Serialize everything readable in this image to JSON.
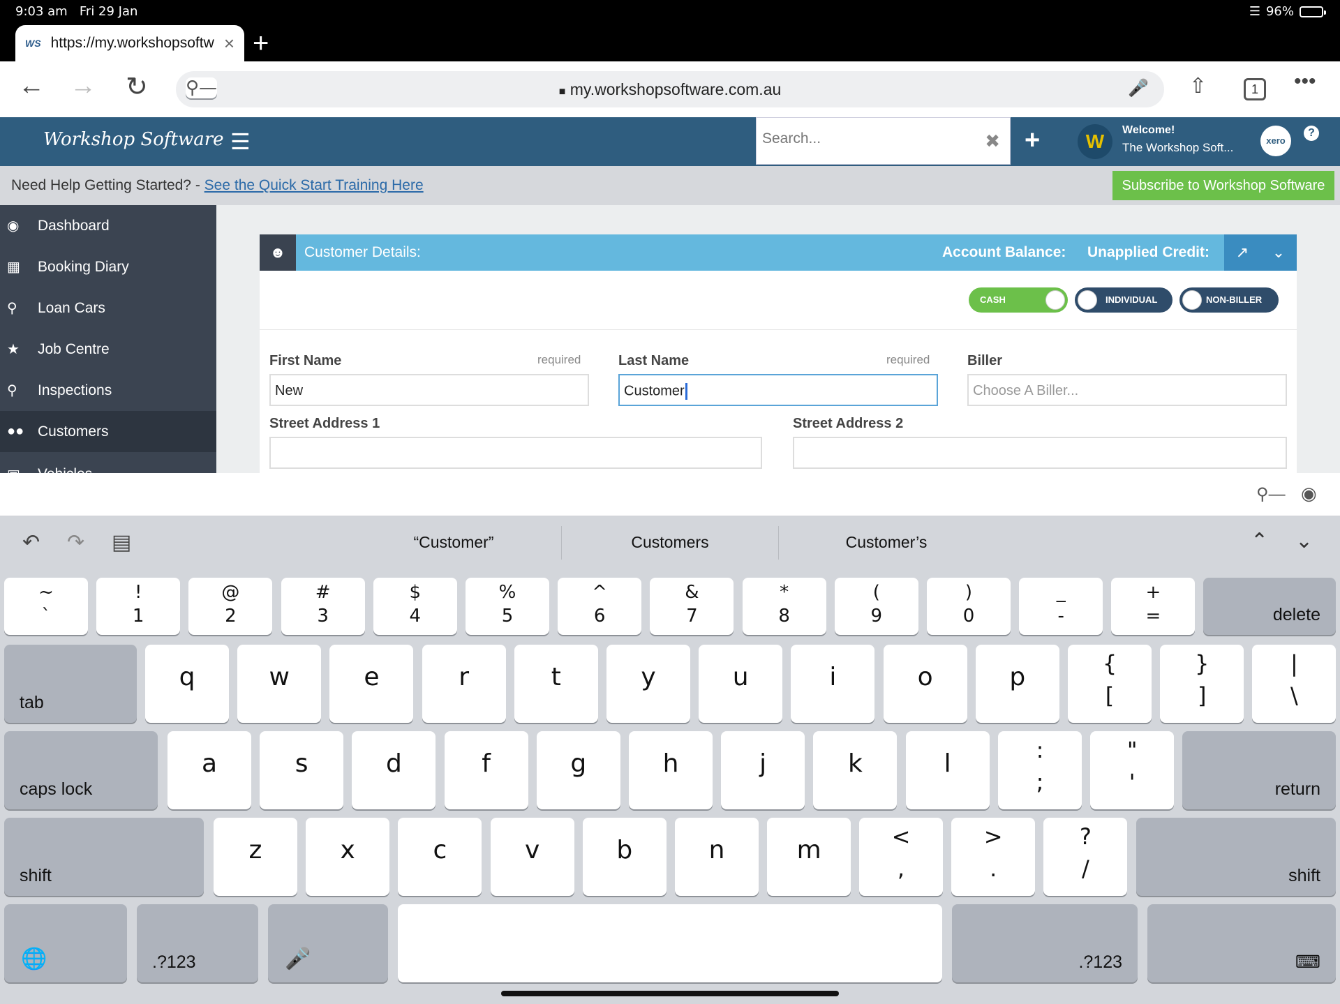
{
  "status": {
    "time": "9:03 am",
    "date": "Fri 29 Jan",
    "battery": "96%",
    "battery_level": 0.96
  },
  "browser": {
    "tab_favicon": "WS",
    "tab_title": "https://my.workshopsoftw",
    "tab_close": "×",
    "new_tab": "+",
    "url": "my.workshopsoftware.com.au",
    "tab_count": "1",
    "icons": [
      "back-arrow-icon",
      "forward-arrow-icon",
      "reload-icon",
      "key-icon",
      "lock-icon",
      "microphone-icon",
      "share-icon",
      "tabs-icon",
      "more-icon"
    ]
  },
  "app": {
    "brand": "Workshop Software",
    "search_placeholder": "Search...",
    "welcome_line1": "Welcome!",
    "welcome_line2": "The Workshop Soft...",
    "xero_label": "xero",
    "help_label": "?"
  },
  "helpstrip": {
    "prefix": "Need Help Getting Started? - ",
    "link": "See the Quick Start Training Here",
    "subscribe": "Subscribe to Workshop Software"
  },
  "sidebar": {
    "items": [
      {
        "label": "Dashboard",
        "icon": "dashboard-icon"
      },
      {
        "label": "Booking Diary",
        "icon": "calendar-icon"
      },
      {
        "label": "Loan Cars",
        "icon": "search-icon"
      },
      {
        "label": "Job Centre",
        "icon": "star-icon"
      },
      {
        "label": "Inspections",
        "icon": "search-icon"
      },
      {
        "label": "Customers",
        "icon": "users-icon",
        "active": true
      },
      {
        "label": "Vehicles",
        "icon": "car-icon"
      }
    ]
  },
  "panel": {
    "title": "Customer Details:",
    "account_balance": "Account Balance:",
    "unapplied_credit": "Unapplied Credit:",
    "toggles": {
      "cash": "CASH",
      "individual": "INDIVIDUAL",
      "non_biller": "NON-BILLER"
    },
    "fields": {
      "first_name_label": "First Name",
      "first_name_value": "New",
      "last_name_label": "Last Name",
      "last_name_value": "Customer",
      "required": "required",
      "biller_label": "Biller",
      "biller_placeholder": "Choose A Biller...",
      "street1_label": "Street Address 1",
      "street2_label": "Street Address 2"
    }
  },
  "keyboard": {
    "suggestions": [
      "“Customer”",
      "Customers",
      "Customer’s"
    ],
    "row_num": [
      [
        "~",
        "`"
      ],
      [
        "!",
        "1"
      ],
      [
        "@",
        "2"
      ],
      [
        "#",
        "3"
      ],
      [
        "$",
        "4"
      ],
      [
        "%",
        "5"
      ],
      [
        "^",
        "6"
      ],
      [
        "&",
        "7"
      ],
      [
        "*",
        "8"
      ],
      [
        "(",
        "9"
      ],
      [
        ")",
        "0"
      ],
      [
        "_",
        "-"
      ],
      [
        "+",
        "="
      ]
    ],
    "delete": "delete",
    "tab": "tab",
    "row_q": [
      "q",
      "w",
      "e",
      "r",
      "t",
      "y",
      "u",
      "i",
      "o",
      "p"
    ],
    "row_q_sym": [
      [
        "{",
        "["
      ],
      [
        "}",
        "]"
      ],
      [
        "|",
        "\\"
      ]
    ],
    "caps": "caps lock",
    "row_a": [
      "a",
      "s",
      "d",
      "f",
      "g",
      "h",
      "j",
      "k",
      "l"
    ],
    "row_a_sym": [
      [
        ":",
        ";"
      ],
      [
        "\"",
        "'"
      ]
    ],
    "return": "return",
    "shift": "shift",
    "row_z": [
      "z",
      "x",
      "c",
      "v",
      "b",
      "n",
      "m"
    ],
    "row_z_sym": [
      [
        "<",
        ","
      ],
      [
        ">",
        "."
      ],
      [
        "?",
        "/"
      ]
    ],
    "numbers": ".?123"
  }
}
